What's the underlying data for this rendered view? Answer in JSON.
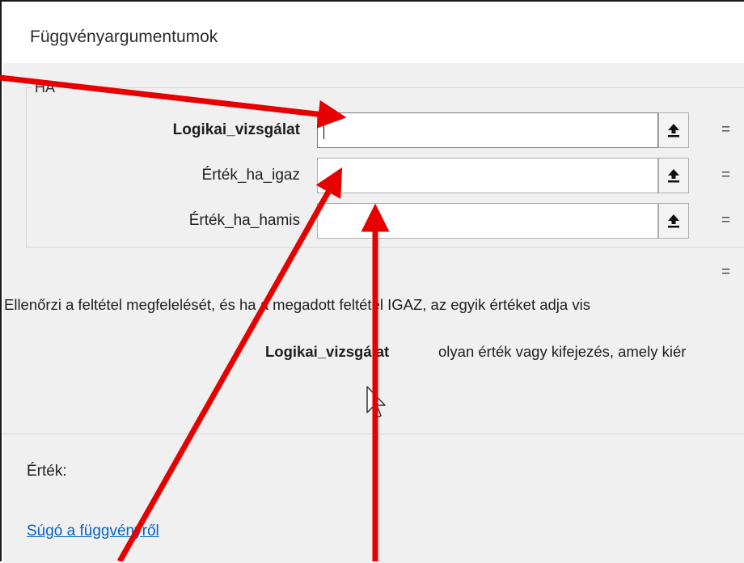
{
  "dialog": {
    "title": "Függvényargumentumok",
    "function_name": "HA"
  },
  "arguments": [
    {
      "label": "Logikai_vizsgálat",
      "value": "",
      "equals": "="
    },
    {
      "label": "Érték_ha_igaz",
      "value": "",
      "equals": "="
    },
    {
      "label": "Érték_ha_hamis",
      "value": "",
      "equals": "="
    }
  ],
  "formula_result_equals": "=",
  "description": "Ellenőrzi a feltétel megfelelését, és ha a megadott feltétel IGAZ, az egyik értéket adja vis",
  "current_argument": {
    "name": "Logikai_vizsgálat",
    "description": "olyan érték vagy kifejezés, amely kiér"
  },
  "result_label": "Érték:",
  "help_link": "Súgó a függvényről",
  "colors": {
    "annotation_arrow": "#e60000",
    "link": "#0563c1",
    "dialog_background": "#f0f0f0"
  },
  "icons": {
    "collapse_button": "arrow-up-icon",
    "mouse_cursor": "mouse-pointer-icon"
  }
}
